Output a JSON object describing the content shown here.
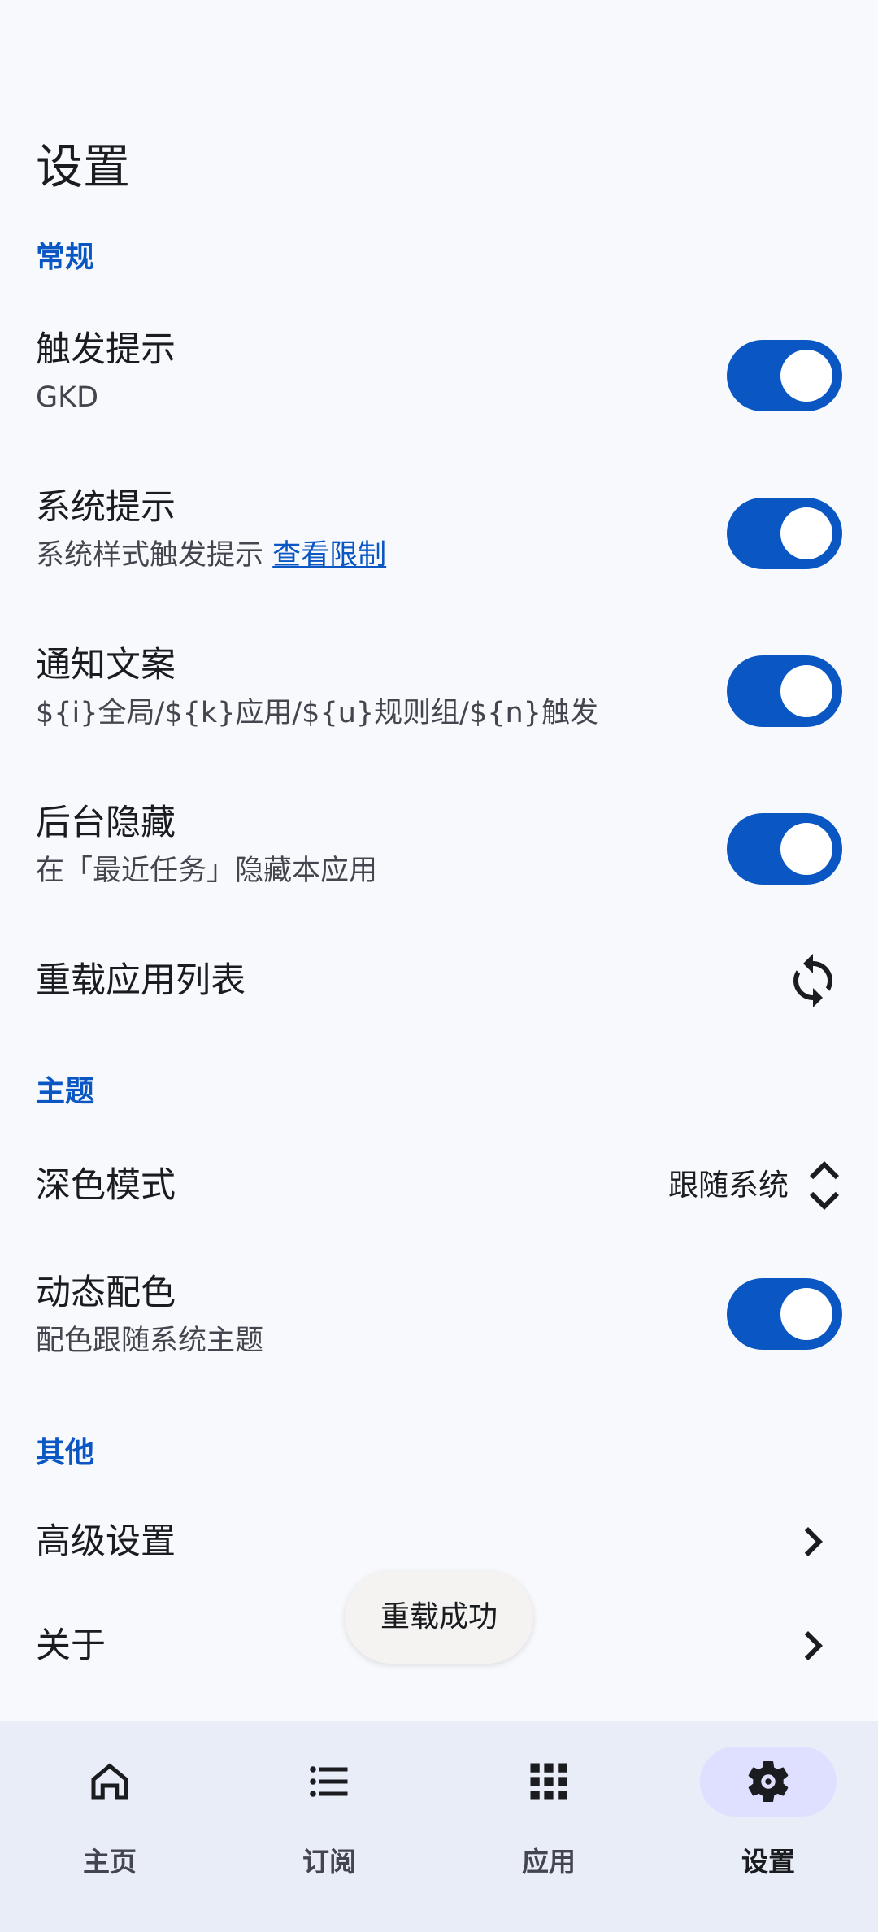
{
  "page": {
    "title": "设置"
  },
  "sections": {
    "general": "常规",
    "theme": "主题",
    "other": "其他"
  },
  "settings": {
    "trigger_tip": {
      "label": "触发提示",
      "sub": "GKD",
      "enabled": true
    },
    "system_tip": {
      "label": "系统提示",
      "sub": "系统样式触发提示",
      "link": "查看限制",
      "enabled": true
    },
    "notify_text": {
      "label": "通知文案",
      "sub": "${i}全局/${k}应用/${u}规则组/${n}触发",
      "enabled": true
    },
    "hide_background": {
      "label": "后台隐藏",
      "sub": "在「最近任务」隐藏本应用",
      "enabled": true
    },
    "reload_apps": {
      "label": "重载应用列表",
      "icon": "refresh-icon"
    },
    "dark_mode": {
      "label": "深色模式",
      "value": "跟随系统",
      "icon": "unfold-icon"
    },
    "dynamic_color": {
      "label": "动态配色",
      "sub": "配色跟随系统主题",
      "enabled": true
    },
    "advanced": {
      "label": "高级设置",
      "icon": "chevron-right-icon"
    },
    "about": {
      "label": "关于",
      "icon": "chevron-right-icon"
    }
  },
  "toast": {
    "text": "重载成功"
  },
  "nav": {
    "items": [
      {
        "label": "主页",
        "icon": "home-icon",
        "active": false
      },
      {
        "label": "订阅",
        "icon": "list-icon",
        "active": false
      },
      {
        "label": "应用",
        "icon": "apps-grid-icon",
        "active": false
      },
      {
        "label": "设置",
        "icon": "gear-icon",
        "active": true
      }
    ]
  },
  "colors": {
    "accent": "#0a57c4",
    "background": "#f8f9fd",
    "navbar": "#e9edf7",
    "active_pill": "#dfe0ff"
  }
}
